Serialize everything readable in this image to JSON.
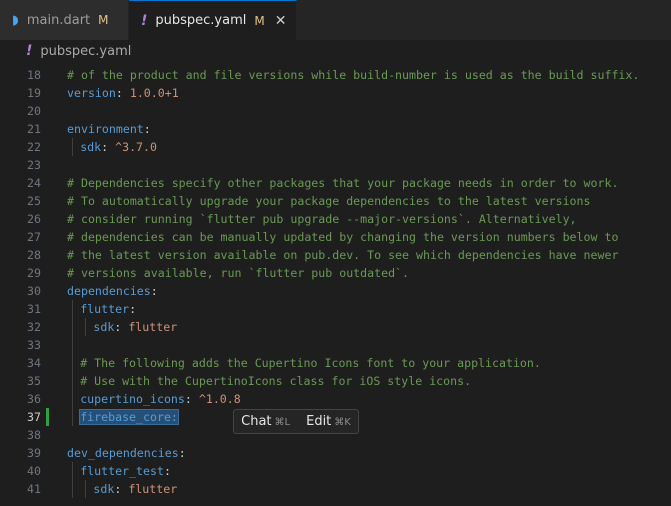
{
  "tabs": [
    {
      "icon": "dart-icon",
      "label": "main.dart",
      "status": "M",
      "active": false
    },
    {
      "icon": "yaml-icon",
      "label": "pubspec.yaml",
      "status": "M",
      "active": true,
      "close": "✕"
    }
  ],
  "breadcrumb": {
    "icon_glyph": "!",
    "label": "pubspec.yaml"
  },
  "hint": {
    "chat": "Chat",
    "chat_kbd": "⌘L",
    "edit": "Edit",
    "edit_kbd": "⌘K"
  },
  "colors": {
    "comment": "#6a9955",
    "key": "#569cd6",
    "value": "#ce9178",
    "background": "#1e1e1e"
  },
  "lines": [
    {
      "n": "18",
      "indent": 0,
      "parts": [
        {
          "t": "# of the product and file versions while build-number is used as the build suffix.",
          "c": "cm"
        }
      ]
    },
    {
      "n": "19",
      "indent": 0,
      "parts": [
        {
          "t": "version",
          "c": "key"
        },
        {
          "t": ": ",
          "c": "punc"
        },
        {
          "t": "1.0.0+1",
          "c": "val"
        }
      ]
    },
    {
      "n": "20",
      "indent": 0,
      "parts": []
    },
    {
      "n": "21",
      "indent": 0,
      "parts": [
        {
          "t": "environment",
          "c": "key"
        },
        {
          "t": ":",
          "c": "punc"
        }
      ]
    },
    {
      "n": "22",
      "indent": 1,
      "parts": [
        {
          "t": "sdk",
          "c": "key"
        },
        {
          "t": ": ",
          "c": "punc"
        },
        {
          "t": "^3.7.0",
          "c": "val"
        }
      ]
    },
    {
      "n": "23",
      "indent": 0,
      "parts": []
    },
    {
      "n": "24",
      "indent": 0,
      "parts": [
        {
          "t": "# Dependencies specify other packages that your package needs in order to work.",
          "c": "cm"
        }
      ]
    },
    {
      "n": "25",
      "indent": 0,
      "parts": [
        {
          "t": "# To automatically upgrade your package dependencies to the latest versions",
          "c": "cm"
        }
      ]
    },
    {
      "n": "26",
      "indent": 0,
      "parts": [
        {
          "t": "# consider running `flutter pub upgrade --major-versions`. Alternatively,",
          "c": "cm"
        }
      ]
    },
    {
      "n": "27",
      "indent": 0,
      "parts": [
        {
          "t": "# dependencies can be manually updated by changing the version numbers below to",
          "c": "cm"
        }
      ]
    },
    {
      "n": "28",
      "indent": 0,
      "parts": [
        {
          "t": "# the latest version available on pub.dev. To see which dependencies have newer",
          "c": "cm"
        }
      ]
    },
    {
      "n": "29",
      "indent": 0,
      "parts": [
        {
          "t": "# versions available, run `flutter pub outdated`.",
          "c": "cm"
        }
      ]
    },
    {
      "n": "30",
      "indent": 0,
      "parts": [
        {
          "t": "dependencies",
          "c": "key"
        },
        {
          "t": ":",
          "c": "punc"
        }
      ]
    },
    {
      "n": "31",
      "indent": 1,
      "parts": [
        {
          "t": "flutter",
          "c": "key"
        },
        {
          "t": ":",
          "c": "punc"
        }
      ]
    },
    {
      "n": "32",
      "indent": 2,
      "parts": [
        {
          "t": "sdk",
          "c": "key"
        },
        {
          "t": ": ",
          "c": "punc"
        },
        {
          "t": "flutter",
          "c": "val"
        }
      ]
    },
    {
      "n": "33",
      "indent": 1,
      "parts": []
    },
    {
      "n": "34",
      "indent": 1,
      "parts": [
        {
          "t": "# The following adds the Cupertino Icons font to your application.",
          "c": "cm"
        }
      ]
    },
    {
      "n": "35",
      "indent": 1,
      "parts": [
        {
          "t": "# Use with the CupertinoIcons class for iOS style icons.",
          "c": "cm"
        }
      ]
    },
    {
      "n": "36",
      "indent": 1,
      "parts": [
        {
          "t": "cupertino_icons",
          "c": "key"
        },
        {
          "t": ": ",
          "c": "punc"
        },
        {
          "t": "^1.0.8",
          "c": "val"
        }
      ]
    },
    {
      "n": "37",
      "indent": 1,
      "current": true,
      "modified": true,
      "parts": [
        {
          "t": "firebase_core:",
          "c": "key sel"
        }
      ]
    },
    {
      "n": "38",
      "indent": 0,
      "parts": []
    },
    {
      "n": "39",
      "indent": 0,
      "parts": [
        {
          "t": "dev_dependencies",
          "c": "key"
        },
        {
          "t": ":",
          "c": "punc"
        }
      ]
    },
    {
      "n": "40",
      "indent": 1,
      "parts": [
        {
          "t": "flutter_test",
          "c": "key"
        },
        {
          "t": ":",
          "c": "punc"
        }
      ]
    },
    {
      "n": "41",
      "indent": 2,
      "parts": [
        {
          "t": "sdk",
          "c": "key"
        },
        {
          "t": ": ",
          "c": "punc"
        },
        {
          "t": "flutter",
          "c": "val"
        }
      ]
    }
  ]
}
